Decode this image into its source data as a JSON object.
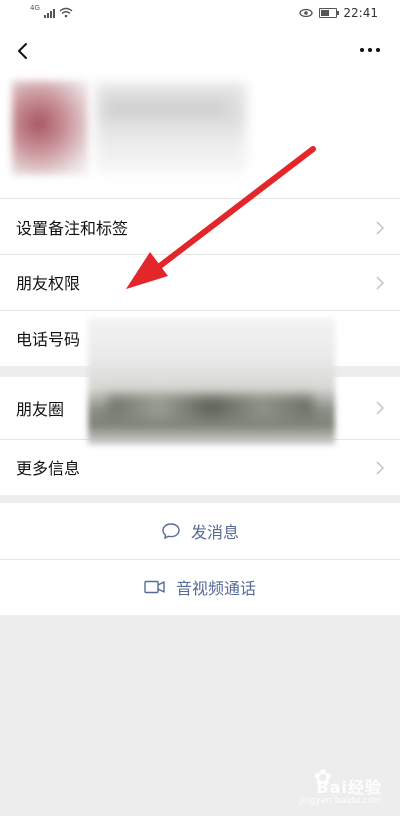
{
  "status_bar": {
    "network": "4G",
    "time": "22:41"
  },
  "header": {
    "back": "back",
    "more": "more"
  },
  "menu_group1": [
    {
      "label": "设置备注和标签"
    },
    {
      "label": "朋友权限"
    },
    {
      "label": "电话号码"
    }
  ],
  "menu_group2": [
    {
      "label": "朋友圈"
    },
    {
      "label": "更多信息"
    }
  ],
  "actions": {
    "message_label": "发消息",
    "message_icon": "chat-bubble-icon",
    "call_label": "音视频通话",
    "call_icon": "video-camera-icon"
  },
  "colors": {
    "accent": "#576b95",
    "annotation_arrow": "#e3262a",
    "background": "#ededed"
  },
  "watermark": {
    "brand": "Bai经验",
    "url": "jingyan.baidu.com"
  }
}
